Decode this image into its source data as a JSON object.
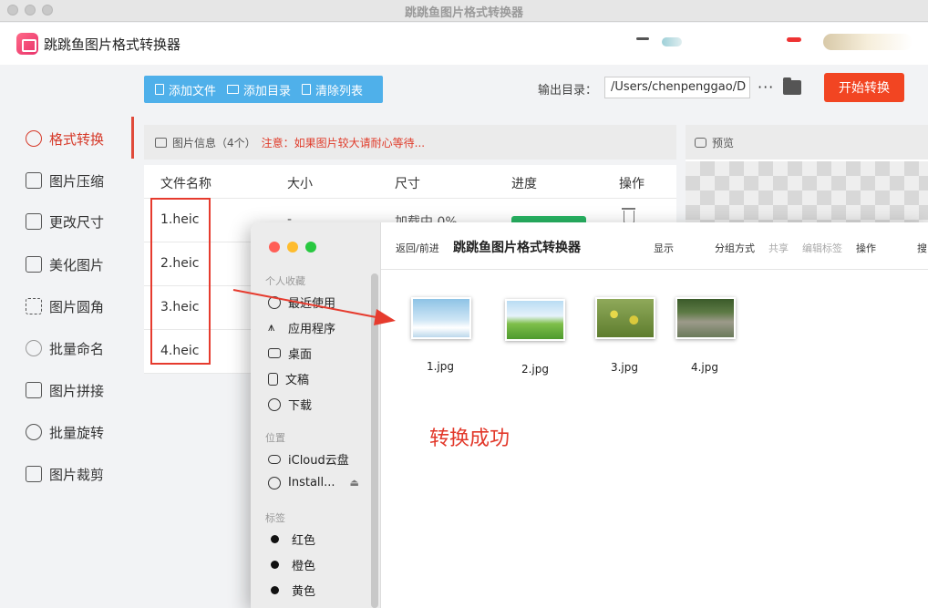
{
  "window": {
    "title": "跳跳鱼图片格式转换器"
  },
  "app": {
    "name": "跳跳鱼图片格式转换器"
  },
  "sidebar": {
    "items": [
      {
        "label": "格式转换",
        "active": true
      },
      {
        "label": "图片压缩"
      },
      {
        "label": "更改尺寸"
      },
      {
        "label": "美化图片"
      },
      {
        "label": "图片圆角"
      },
      {
        "label": "批量命名"
      },
      {
        "label": "图片拼接"
      },
      {
        "label": "批量旋转"
      },
      {
        "label": "图片裁剪"
      }
    ]
  },
  "toolbar": {
    "add_file": "添加文件",
    "add_dir": "添加目录",
    "clear_list": "清除列表",
    "output_label": "输出目录：",
    "output_path": "/Users/chenpenggao/D",
    "more": "···",
    "start": "开始转换"
  },
  "file_panel": {
    "title": "图片信息（4个）",
    "warning": "注意：如果图片较大请耐心等待...",
    "columns": [
      "文件名称",
      "大小",
      "尺寸",
      "进度",
      "操作"
    ],
    "rows": [
      {
        "name": "1.heic",
        "size": "-",
        "dims": "加载中 0%"
      },
      {
        "name": "2.heic"
      },
      {
        "name": "3.heic"
      },
      {
        "name": "4.heic"
      }
    ]
  },
  "preview": {
    "title": "预览"
  },
  "finder": {
    "nav": "返回/前进",
    "title": "跳跳鱼图片格式转换器",
    "toolbar": [
      "显示",
      "分组方式",
      "共享",
      "编辑标签",
      "操作",
      "搜"
    ],
    "favorites_header": "个人收藏",
    "favorites": [
      "最近使用",
      "应用程序",
      "桌面",
      "文稿",
      "下载"
    ],
    "locations_header": "位置",
    "locations": [
      "iCloud云盘",
      "Install..."
    ],
    "tags_header": "标签",
    "tags": [
      {
        "label": "红色",
        "color": "#111111"
      },
      {
        "label": "橙色",
        "color": "#111111"
      },
      {
        "label": "黄色",
        "color": "#111111"
      }
    ],
    "files": [
      "1.jpg",
      "2.jpg",
      "3.jpg",
      "4.jpg"
    ]
  },
  "annotation": {
    "success": "转换成功"
  },
  "colors": {
    "accent": "#f24522",
    "toolbar_blue": "#4fb0ea",
    "progress": "#28b463",
    "annotation_red": "#e63b2e"
  }
}
